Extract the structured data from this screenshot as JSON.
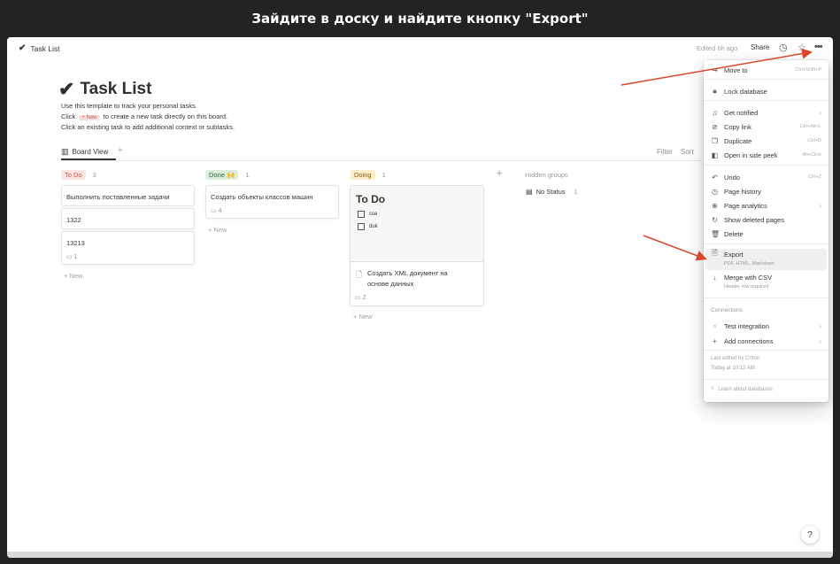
{
  "banner": {
    "text": "Зайдите в доску и найдите кнопку \"Export\""
  },
  "topbar": {
    "breadcrumb": "Task List",
    "edited": "Edited 6h ago",
    "share": "Share"
  },
  "page": {
    "title": "Task List",
    "desc1": "Use this template to track your personal tasks.",
    "desc2_pre": "Click",
    "desc2_tag": "+ New",
    "desc2_post": "to create a new task directly on this board.",
    "desc3": "Click an existing task to add additional context or subtasks."
  },
  "view": {
    "label": "Board View",
    "filter": "Filter",
    "sort": "Sort"
  },
  "board": {
    "columns": [
      {
        "tag": "To Do",
        "count": "3",
        "color": "#fbe4e4",
        "text_color": "#c25a4b"
      },
      {
        "tag": "Done 🙌",
        "count": "1",
        "color": "#dbeddb",
        "text_color": "#2f6a3a"
      },
      {
        "tag": "Doing",
        "count": "1",
        "color": "#fdecc8",
        "text_color": "#8a5c14"
      }
    ],
    "todo_cards": [
      {
        "text": "Выполнить поставленные задачи"
      },
      {
        "text": "1322"
      },
      {
        "text": "13213",
        "comments": "1"
      }
    ],
    "done_card": {
      "text": "Создать объекты классов машин",
      "comments": "4"
    },
    "doing_card": {
      "cover_title": "To Do",
      "cover_items": [
        "sse",
        "duk"
      ],
      "text_line1": "Создать XML документ на",
      "text_line2": "основе данных",
      "comments": "2"
    },
    "new_label": "New",
    "hidden_groups": "Hidden groups",
    "no_status": "No Status",
    "no_status_count": "1"
  },
  "menu": {
    "move_to": "Move to",
    "move_to_short": "Ctrl+Shift+P",
    "lock": "Lock database",
    "notified": "Get notified",
    "copy_link": "Copy link",
    "copy_link_short": "Ctrl+Alt+L",
    "duplicate": "Duplicate",
    "duplicate_short": "Ctrl+D",
    "side_peek": "Open in side peek",
    "side_peek_short": "Alt+Click",
    "undo": "Undo",
    "undo_short": "Ctrl+Z",
    "history": "Page history",
    "analytics": "Page analytics",
    "deleted": "Show deleted pages",
    "delete": "Delete",
    "export": "Export",
    "export_sub": "PDF, HTML, Markdown",
    "merge": "Merge with CSV",
    "merge_sub": "Header row required",
    "connections": "Connections",
    "test_integration": "Test integration",
    "add_connections": "Add connections",
    "last_edited": "Last edited by Crlmo",
    "last_edited_time": "Today at 10:12 AM",
    "learn": "Learn about databases"
  },
  "help": "?",
  "colors": {
    "arrow": "#d9462b",
    "banner_bg": "#232323"
  }
}
